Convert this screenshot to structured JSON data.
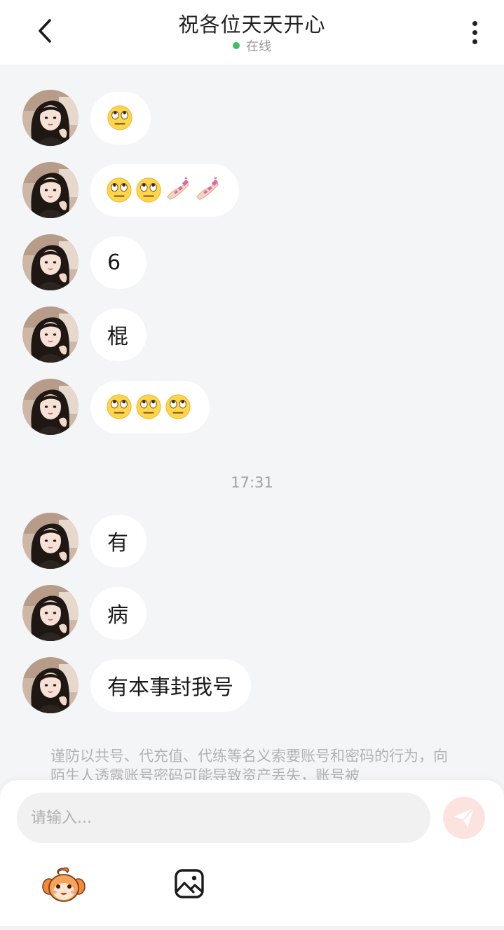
{
  "header": {
    "title": "祝各位天天开心",
    "status": "在线",
    "status_color": "#3ec15a"
  },
  "messages": [
    {
      "type": "emoji",
      "emojis": [
        "rolling-eyes"
      ]
    },
    {
      "type": "emoji",
      "emojis": [
        "rolling-eyes",
        "rolling-eyes",
        "nail-polish",
        "nail-polish"
      ]
    },
    {
      "type": "text",
      "text": "6"
    },
    {
      "type": "text",
      "text": "棍"
    },
    {
      "type": "emoji",
      "emojis": [
        "rolling-eyes",
        "rolling-eyes",
        "rolling-eyes"
      ]
    },
    {
      "type": "text",
      "text": "有"
    },
    {
      "type": "text",
      "text": "病"
    },
    {
      "type": "text",
      "text": "有本事封我号"
    }
  ],
  "time_divider": "17:31",
  "notice": "谨防以共号、代充值、代练等名义索要账号和密码的行为，向陌生人透露账号密码可能导致资产丢失，账号被",
  "composer": {
    "placeholder": "请输入...",
    "send_icon": "send-icon",
    "tools": [
      "mascot-sticker-icon",
      "image-icon"
    ]
  },
  "colors": {
    "background": "#f4f5f7",
    "bubble": "#ffffff",
    "send_button": "#fde3df",
    "send_icon": "#ffffff"
  }
}
